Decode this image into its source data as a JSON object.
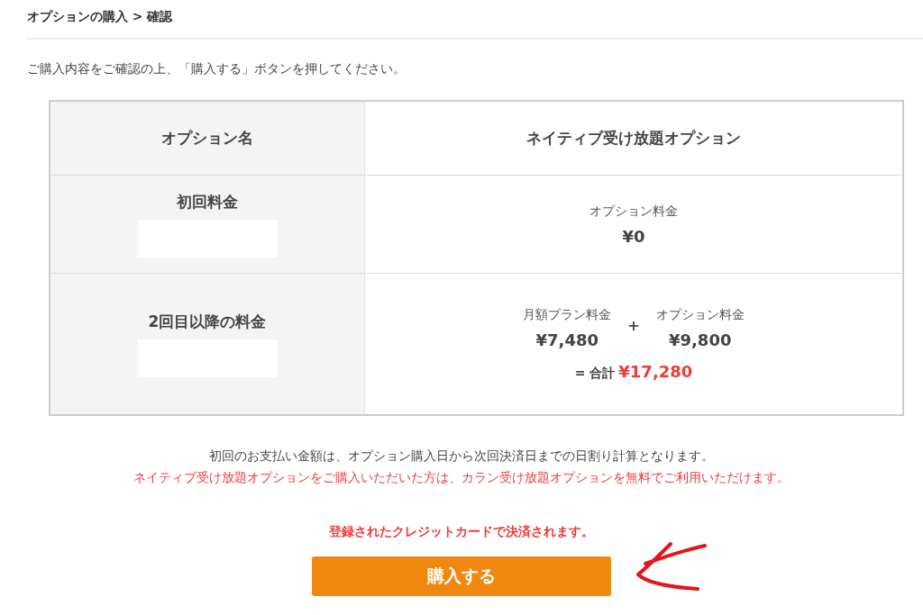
{
  "breadcrumb": "オプションの購入 > 確認",
  "instruction": "ご購入内容をご確認の上、「購入する」ボタンを押してください。",
  "table": {
    "header": {
      "label": "オプション名",
      "value": "ネイティブ受け放題オプション"
    },
    "rows": [
      {
        "kind": "single",
        "label": "初回料金",
        "redacted": true,
        "items": [
          {
            "label": "オプション料金",
            "amount": "¥0"
          }
        ]
      },
      {
        "kind": "sum",
        "label": "2回目以降の料金",
        "redacted": true,
        "items": [
          {
            "label": "月額プラン料金",
            "amount": "¥7,480"
          },
          {
            "label": "オプション料金",
            "amount": "¥9,800"
          }
        ],
        "operator": "+",
        "total_label": "= 合計",
        "total": "¥17,280"
      }
    ]
  },
  "notes": [
    {
      "kind": "plain",
      "text": "初回のお支払い金額は、オプション購入日から次回決済日までの日割り計算となります。"
    },
    {
      "kind": "alert",
      "text": "ネイティブ受け放題オプションをご購入いただいた方は、カラン受け放題オプションを無料でご利用いただけます。"
    }
  ],
  "payment_notice": "登録されたクレジットカードで決済されます。",
  "purchase_button": "購入する"
}
